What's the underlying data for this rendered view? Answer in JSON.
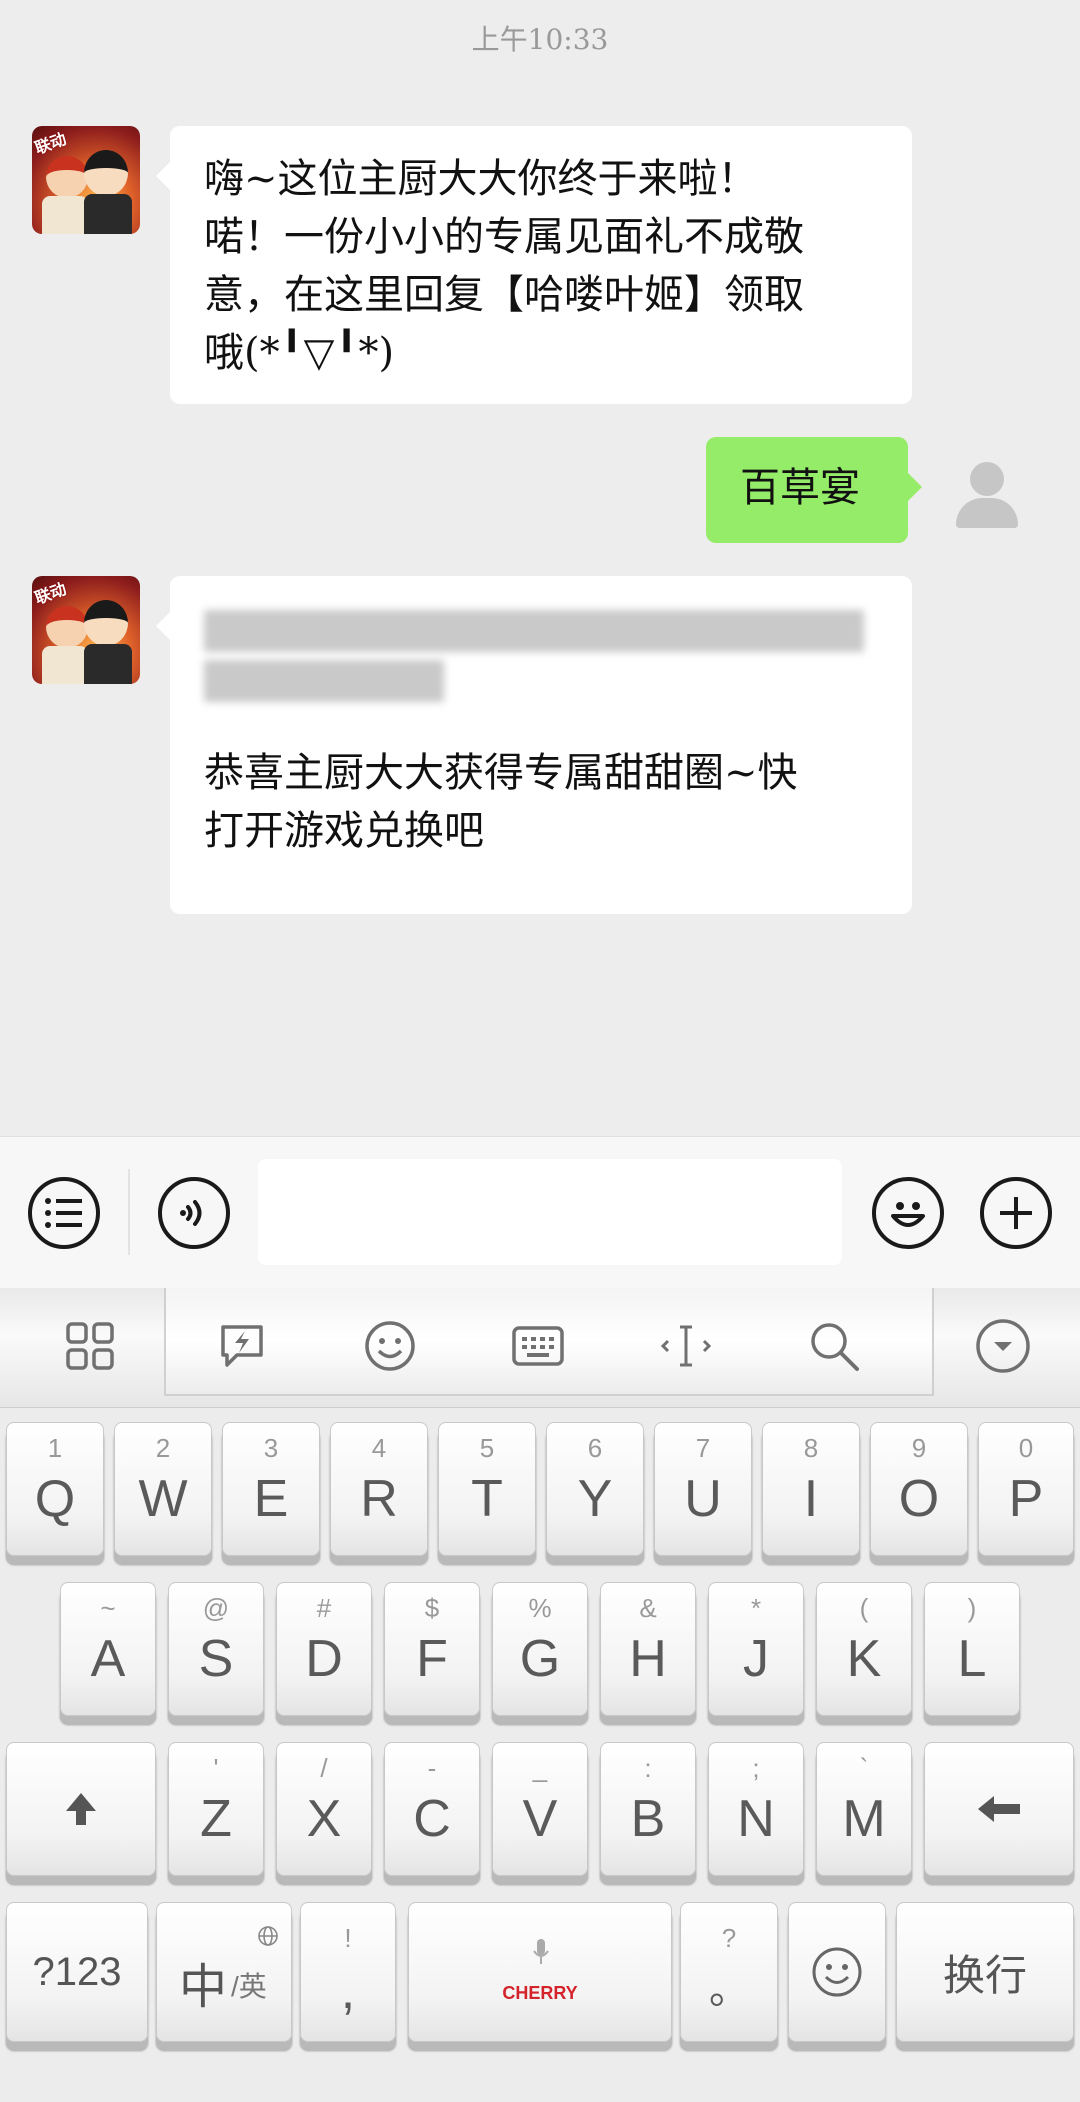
{
  "timestamp": "上午10:33",
  "messages": [
    {
      "sender": "bot",
      "lines": [
        "嗨~这位主厨大大你终于来啦！",
        "喏！一份小小的专属见面礼不成敬",
        "意，在这里回复【哈喽叶姬】领取",
        "哦(*╹▽╹*)"
      ]
    },
    {
      "sender": "user",
      "text": "百草宴"
    },
    {
      "sender": "bot",
      "lines": [
        "恭喜主厨大大获得专属甜甜圈~快",
        "打开游戏兑换吧"
      ]
    }
  ],
  "avatar": {
    "bot_tag": "联动"
  },
  "input_bar": {
    "menu_icon": "list-icon",
    "voice_icon": "voice-icon",
    "emoji_icon": "emoji-icon",
    "plus_icon": "plus-icon",
    "input_value": ""
  },
  "keyboard_toolbar": [
    "apps-icon",
    "quick-reply-icon",
    "emoji-icon",
    "keyboard-icon",
    "cursor-icon",
    "search-icon",
    "collapse-icon"
  ],
  "keyboard": {
    "row1": [
      {
        "sub": "1",
        "main": "Q"
      },
      {
        "sub": "2",
        "main": "W"
      },
      {
        "sub": "3",
        "main": "E"
      },
      {
        "sub": "4",
        "main": "R"
      },
      {
        "sub": "5",
        "main": "T"
      },
      {
        "sub": "6",
        "main": "Y"
      },
      {
        "sub": "7",
        "main": "U"
      },
      {
        "sub": "8",
        "main": "I"
      },
      {
        "sub": "9",
        "main": "O"
      },
      {
        "sub": "0",
        "main": "P"
      }
    ],
    "row2": [
      {
        "sub": "~",
        "main": "A"
      },
      {
        "sub": "@",
        "main": "S"
      },
      {
        "sub": "#",
        "main": "D"
      },
      {
        "sub": "$",
        "main": "F"
      },
      {
        "sub": "%",
        "main": "G"
      },
      {
        "sub": "&",
        "main": "H"
      },
      {
        "sub": "*",
        "main": "J"
      },
      {
        "sub": "(",
        "main": "K"
      },
      {
        "sub": ")",
        "main": "L"
      }
    ],
    "row3": [
      {
        "sub": "'",
        "main": "Z"
      },
      {
        "sub": "/",
        "main": "X"
      },
      {
        "sub": "-",
        "main": "C"
      },
      {
        "sub": "_",
        "main": "V"
      },
      {
        "sub": ":",
        "main": "B"
      },
      {
        "sub": ";",
        "main": "N"
      },
      {
        "sub": "`",
        "main": "M"
      }
    ],
    "num_key": "?123",
    "lang_key_main": "中",
    "lang_key_sub": "/英",
    "comma_sub": "!",
    "comma_main": ",",
    "space_brand": "CHERRY",
    "period_sub": "?",
    "period_main": "。",
    "enter_key": "换行"
  },
  "colors": {
    "background": "#ededed",
    "sent_bubble": "#95ec69",
    "brand": "#d4232b"
  }
}
